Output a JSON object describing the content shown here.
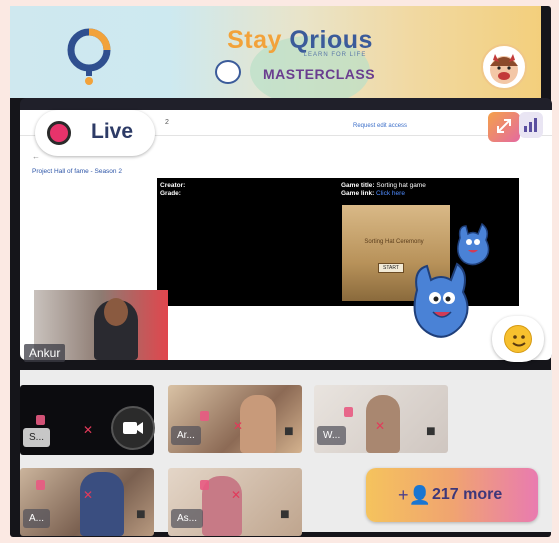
{
  "header": {
    "brand_part1": "Stay",
    "brand_part2": "Qrious",
    "tagline": "LEARN FOR LIFE",
    "masterclass_label": "MASTERCLASS"
  },
  "live": {
    "label": "Live"
  },
  "shared_screen": {
    "toolbar_number": "2",
    "request_edit_label": "Request edit access",
    "sidebar_link": "Project Hall of fame - Season 2",
    "slide": {
      "creator_label": "Creator:",
      "grade_label": "Grade:",
      "game_title_label": "Game title:",
      "game_title_value": "Sorting hat game",
      "game_link_label": "Game link:",
      "game_link_value": "Click here",
      "castle_title": "Sorting Hat Ceremony",
      "castle_start": "START"
    }
  },
  "host": {
    "name": "Ankur"
  },
  "participants": [
    {
      "name": "S..."
    },
    {
      "name": "Ar..."
    },
    {
      "name": "W..."
    },
    {
      "name": "A..."
    },
    {
      "name": "As..."
    }
  ],
  "more_button": {
    "label": "217 more"
  },
  "colors": {
    "live_dot": "#e8336b",
    "brand_orange": "#f2a23a",
    "brand_blue": "#3b5b9a",
    "masterclass_purple": "#6a3d8f",
    "mute_red": "#e23a5a"
  },
  "icons": [
    "question-logo-icon",
    "masterclass-icon",
    "avatar-icon",
    "expand-icon",
    "signal-icon",
    "emoji-icon",
    "mic-off-icon",
    "camera-icon",
    "add-people-icon"
  ]
}
